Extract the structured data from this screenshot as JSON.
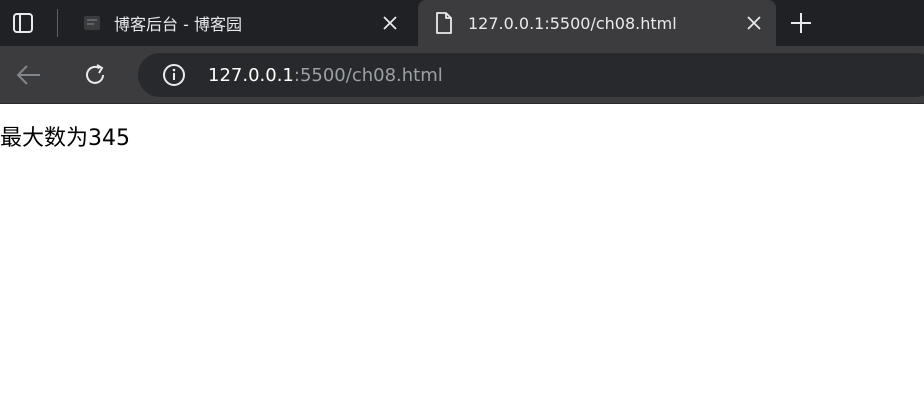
{
  "tabs": [
    {
      "title": "博客后台 - 博客园",
      "active": false,
      "close_icon": "close-icon"
    },
    {
      "title": "127.0.0.1:5500/ch08.html",
      "active": true,
      "close_icon": "close-icon",
      "favicon": "file-icon"
    }
  ],
  "address_bar": {
    "url_host": "127.0.0.1",
    "url_rest": ":5500/ch08.html"
  },
  "page": {
    "text": "最大数为345"
  },
  "colors": {
    "tabbar_bg": "#202124",
    "active_tab_bg": "#3c3c3f",
    "omnibox_bg": "#28292c",
    "url_host": "#ffffff",
    "url_rest": "#9aa0a6"
  }
}
